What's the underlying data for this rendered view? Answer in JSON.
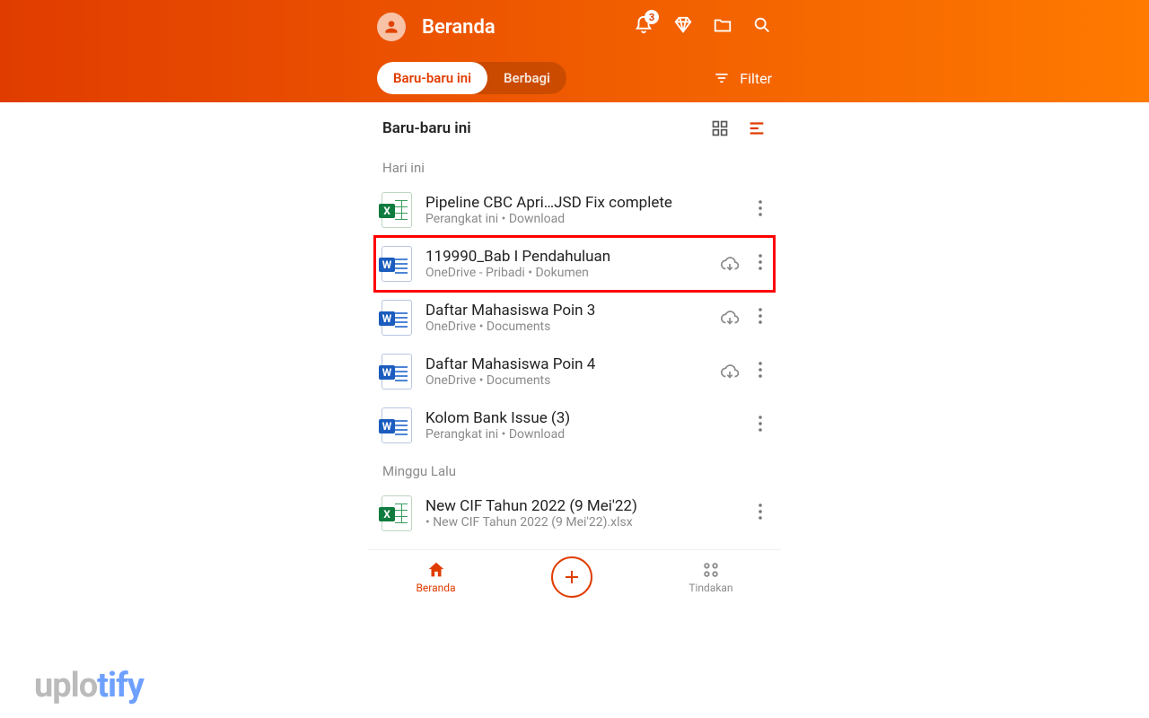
{
  "header": {
    "title": "Beranda",
    "notification_count": "3"
  },
  "tabs": {
    "items": [
      "Baru-baru ini",
      "Berbagi"
    ],
    "active_index": 0,
    "filter_label": "Filter"
  },
  "section": {
    "title": "Baru-baru ini"
  },
  "groups": [
    {
      "label": "Hari ini",
      "files": [
        {
          "type": "excel",
          "name": "Pipeline CBC Apri…JSD Fix complete",
          "sub": "Perangkat ini • Download",
          "cloud": false,
          "highlight": false
        },
        {
          "type": "word",
          "name": "119990_Bab I  Pendahuluan",
          "sub": "OneDrive - Pribadi • Dokumen",
          "cloud": true,
          "highlight": true
        },
        {
          "type": "word",
          "name": "Daftar Mahasiswa Poin 3",
          "sub": "OneDrive • Documents",
          "cloud": true,
          "highlight": false
        },
        {
          "type": "word",
          "name": "Daftar Mahasiswa Poin 4",
          "sub": "OneDrive • Documents",
          "cloud": true,
          "highlight": false
        },
        {
          "type": "word",
          "name": "Kolom Bank Issue (3)",
          "sub": "Perangkat ini • Download",
          "cloud": false,
          "highlight": false
        }
      ]
    },
    {
      "label": "Minggu Lalu",
      "files": [
        {
          "type": "excel",
          "name": "New CIF Tahun 2022 (9 Mei'22)",
          "sub": " • New CIF Tahun 2022 (9 Mei'22).xlsx",
          "cloud": false,
          "highlight": false
        }
      ]
    }
  ],
  "bottom_nav": {
    "home": "Beranda",
    "actions": "Tindakan"
  },
  "watermark": {
    "a": "uplo",
    "b": "tify"
  }
}
